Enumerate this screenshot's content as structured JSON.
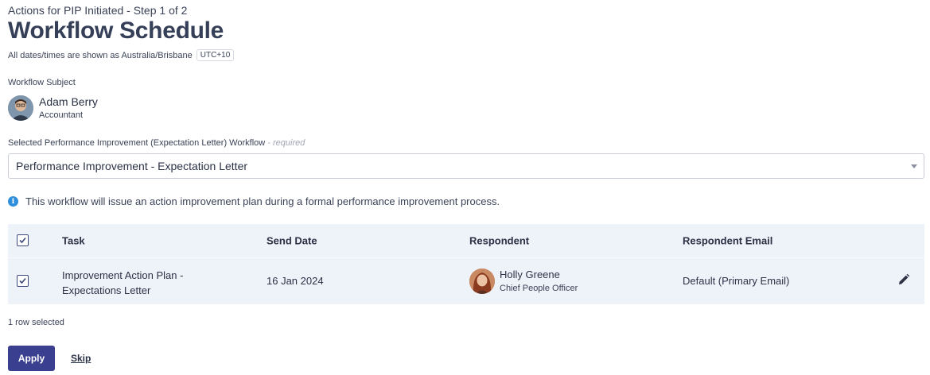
{
  "header": {
    "step": "Actions for PIP Initiated - Step 1 of 2",
    "title": "Workflow Schedule",
    "timezone_note": "All dates/times are shown as Australia/Brisbane",
    "timezone_badge": "UTC+10"
  },
  "subject": {
    "label": "Workflow Subject",
    "name": "Adam Berry",
    "role": "Accountant"
  },
  "workflow_select": {
    "label": "Selected Performance Improvement (Expectation Letter) Workflow",
    "required_note": "- required",
    "value": "Performance Improvement - Expectation Letter"
  },
  "info_message": "This workflow will issue an action improvement plan during a formal performance improvement process.",
  "table": {
    "columns": [
      "Task",
      "Send Date",
      "Respondent",
      "Respondent Email"
    ],
    "rows": [
      {
        "checked": true,
        "task_line1": "Improvement Action Plan -",
        "task_line2": "Expectations Letter",
        "send_date": "16 Jan 2024",
        "respondent_name": "Holly Greene",
        "respondent_role": "Chief People Officer",
        "respondent_email": "Default (Primary Email)"
      }
    ]
  },
  "footer": {
    "selected_count": "1 row selected",
    "apply_label": "Apply",
    "skip_label": "Skip"
  },
  "colors": {
    "primary_button": "#3b3f8f",
    "table_background": "#eef2f9",
    "info_icon": "#2f8fdc"
  }
}
